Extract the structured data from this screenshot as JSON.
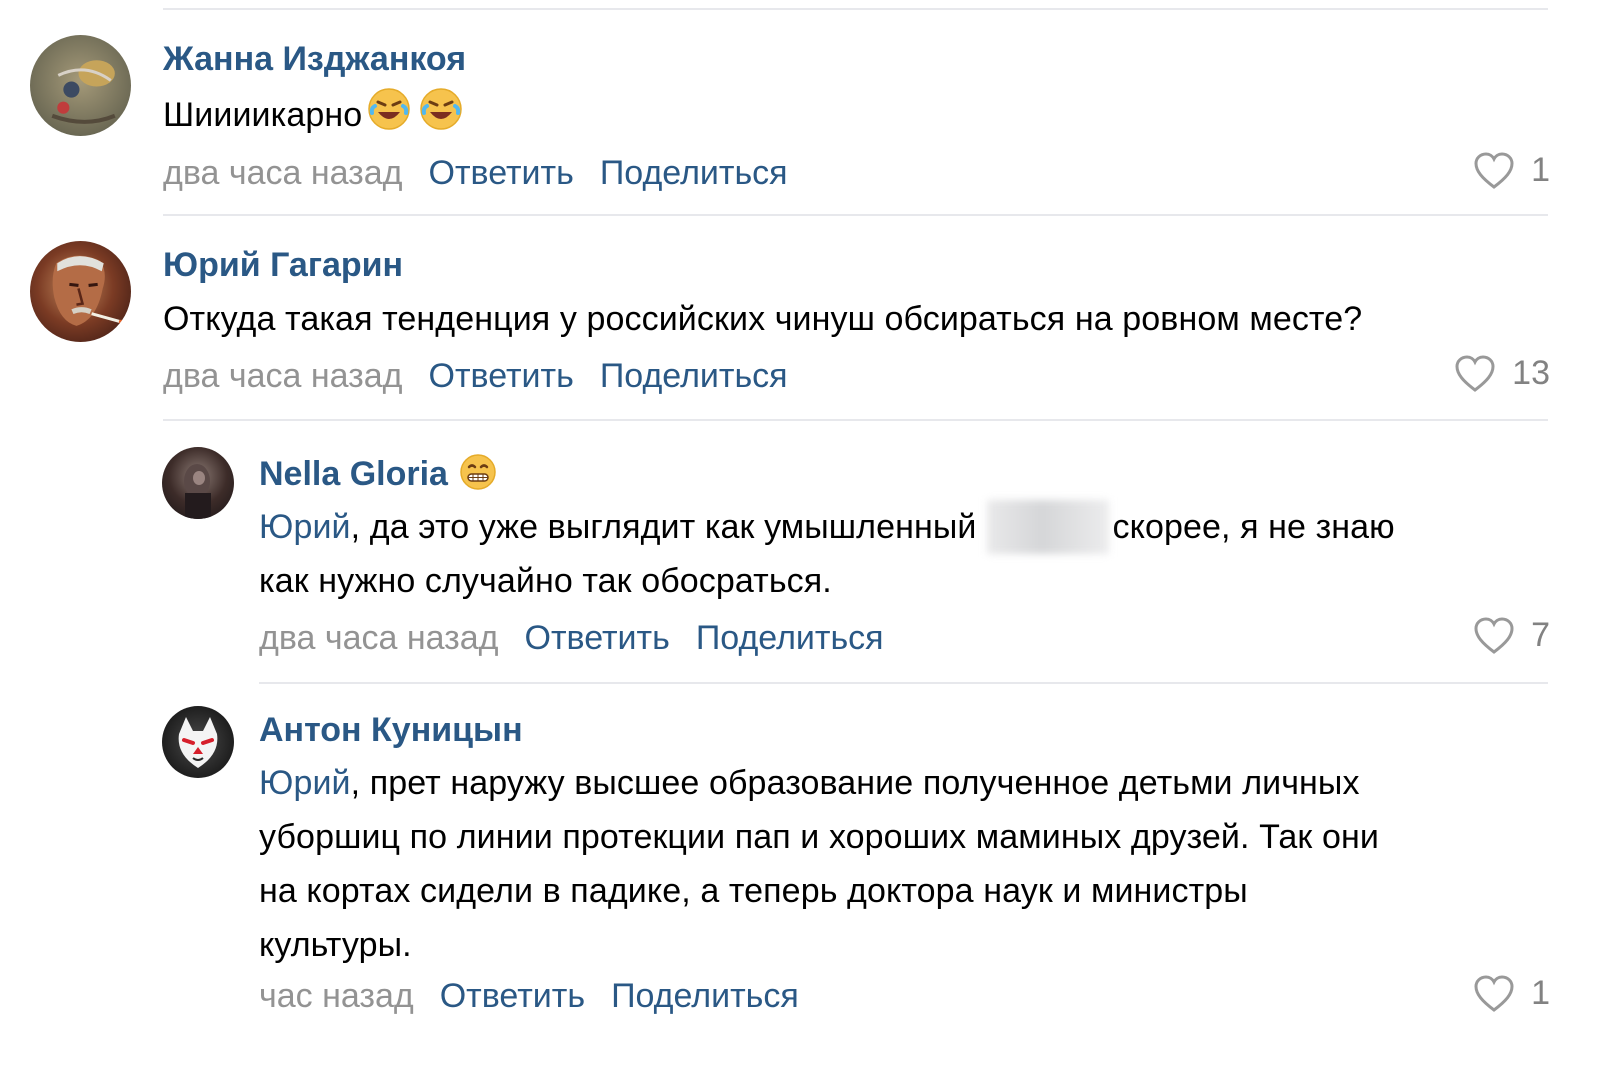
{
  "comments": [
    {
      "author": "Жанна Изджанкоя",
      "text": "Шиииикарно",
      "emoji": [
        "rolling-on-floor-laughing-icon",
        "rolling-on-floor-laughing-icon"
      ],
      "time": "два часа назад",
      "reply_label": "Ответить",
      "share_label": "Поделиться",
      "likes": "1"
    },
    {
      "author": "Юрий Гагарин",
      "text": "Откуда такая тенденция у российских чинуш обсираться на ровном месте?",
      "time": "два часа назад",
      "reply_label": "Ответить",
      "share_label": "Поделиться",
      "likes": "13"
    },
    {
      "author": "Nella Gloria",
      "author_emoji": "grimacing-face-icon",
      "mention": "Юрий",
      "text_part1": ", да это уже выглядит как умышленный",
      "text_part2": "скорее, я не знаю",
      "text_line2": "как нужно случайно так обосраться.",
      "time": "два часа назад",
      "reply_label": "Ответить",
      "share_label": "Поделиться",
      "likes": "7"
    },
    {
      "author": "Антон Куницын",
      "mention": "Юрий",
      "text_line1": ", прет наружу высшее образование полученное детьми личных",
      "text_line2": "уборшиц по линии протекции пап и хороших маминых друзей. Так они",
      "text_line3": "на кортах сидели в падике, а теперь доктора наук и министры",
      "text_line4": "культуры.",
      "time": "час назад",
      "reply_label": "Ответить",
      "share_label": "Поделиться",
      "likes": "1"
    }
  ],
  "colors": {
    "author": "#2a5885",
    "meta": "#939393",
    "divider": "#e7e8ec",
    "like": "#828282"
  }
}
